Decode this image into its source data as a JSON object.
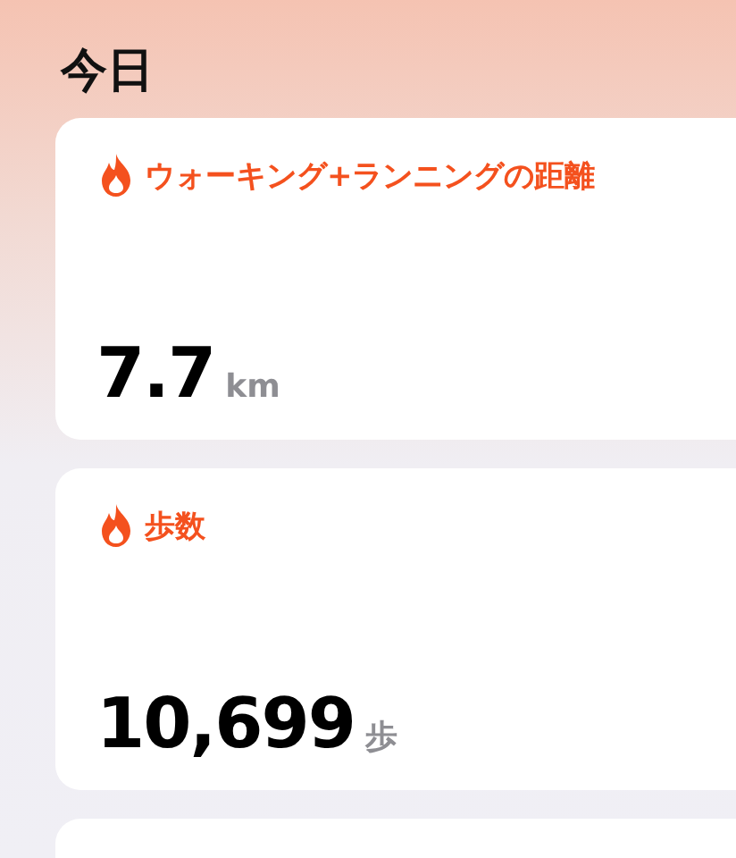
{
  "title": "今日",
  "cards": [
    {
      "label": "ウォーキング+ランニングの距離",
      "value": "7.7",
      "unit": "km"
    },
    {
      "label": "歩数",
      "value": "10,699",
      "unit": "歩"
    }
  ]
}
